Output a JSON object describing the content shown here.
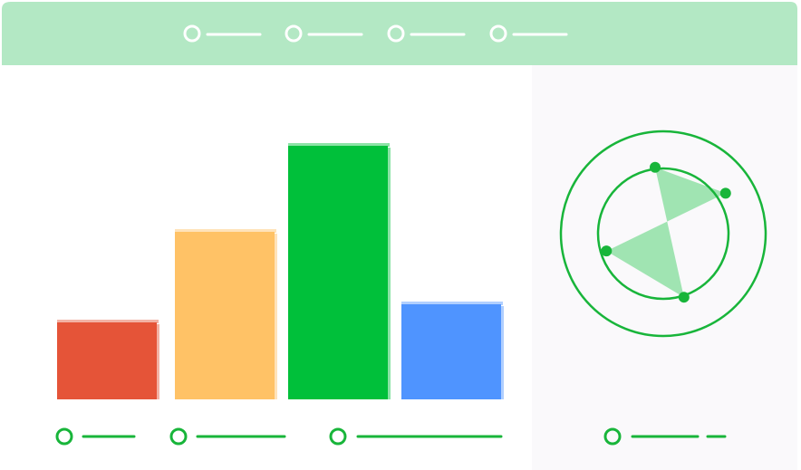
{
  "colors": {
    "header_bg": "#b3e8c4",
    "panel_bg": "#faf9fb",
    "header_mark": "#ffffff",
    "line_accent": "#18b53a",
    "radar_fill": "#8fe0a4",
    "bar_red": "#e55438",
    "bar_orange": "#ffc266",
    "bar_green": "#00c03a",
    "bar_blue": "#4f94ff"
  },
  "header": {
    "icon": "circle-outline-icon",
    "item_count": 4
  },
  "chart_data": [
    {
      "type": "bar",
      "categories": [
        "",
        "",
        "",
        ""
      ],
      "values": [
        85,
        185,
        280,
        105
      ],
      "ylim": [
        0,
        300
      ],
      "series_colors": [
        "#e55438",
        "#ffc266",
        "#00c03a",
        "#4f94ff"
      ],
      "grid": false,
      "legend": "bottom"
    },
    {
      "type": "radar",
      "axes": [
        "",
        "",
        "",
        ""
      ],
      "values": [
        0.9,
        1.0,
        0.8,
        0.9
      ],
      "rings": 2,
      "legend": "bottom"
    }
  ]
}
